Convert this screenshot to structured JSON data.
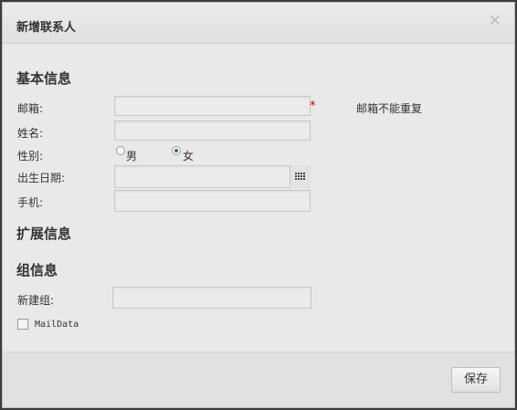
{
  "dialog": {
    "title": "新增联系人",
    "close_icon": "×"
  },
  "basic_info": {
    "section_title": "基本信息",
    "email_label": "邮箱:",
    "email_value": "",
    "email_required_mark": "*",
    "email_hint": "邮箱不能重复",
    "name_label": "姓名:",
    "name_value": "",
    "gender_label": "性别:",
    "gender_options": [
      {
        "label": "男",
        "selected": false
      },
      {
        "label": "女",
        "selected": true
      }
    ],
    "birthday_label": "出生日期:",
    "birthday_value": "",
    "birthday_picker_icon": "calendar-icon",
    "phone_label": "手机:",
    "phone_value": ""
  },
  "extended_info": {
    "section_title": "扩展信息"
  },
  "group_info": {
    "section_title": "组信息",
    "new_group_label": "新建组:",
    "new_group_value": "",
    "mail_data_checkbox_label": "MailData",
    "mail_data_checked": false
  },
  "footer": {
    "save_label": "保存"
  }
}
